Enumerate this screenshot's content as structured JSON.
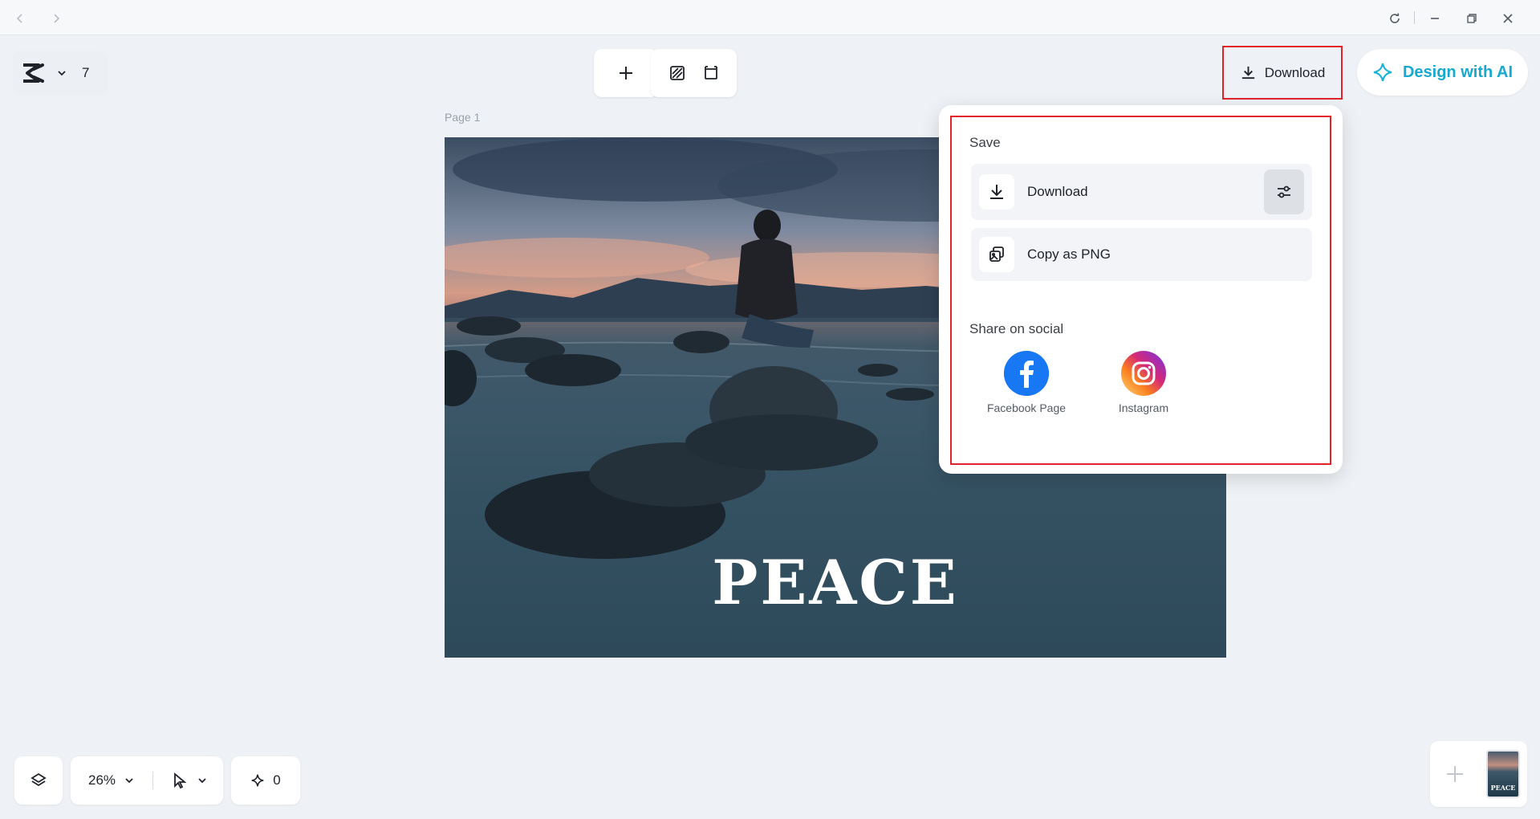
{
  "titlebar": {
    "icons": [
      "back-icon",
      "forward-icon",
      "reload-icon",
      "minimize-icon",
      "restore-icon",
      "close-icon"
    ]
  },
  "brand": {
    "count": "7"
  },
  "toolbar": {
    "icons": [
      "plus-icon",
      "background-icon",
      "resize-icon"
    ]
  },
  "header": {
    "download_label": "Download",
    "design_ai_label": "Design with AI"
  },
  "canvas": {
    "page_label": "Page 1",
    "headline": "PEACE"
  },
  "dropdown": {
    "save_title": "Save",
    "download_label": "Download",
    "copy_label": "Copy as PNG",
    "share_title": "Share on social",
    "social": [
      {
        "name": "Facebook Page",
        "color": "#1877f2"
      },
      {
        "name": "Instagram",
        "color": "#e1306c"
      }
    ]
  },
  "bottom": {
    "zoom": "26%",
    "ai_count": "0"
  },
  "thumbnail": {
    "text": "PEACE"
  },
  "colors": {
    "accent": "#17a9cf",
    "highlight": "#e2232a"
  }
}
